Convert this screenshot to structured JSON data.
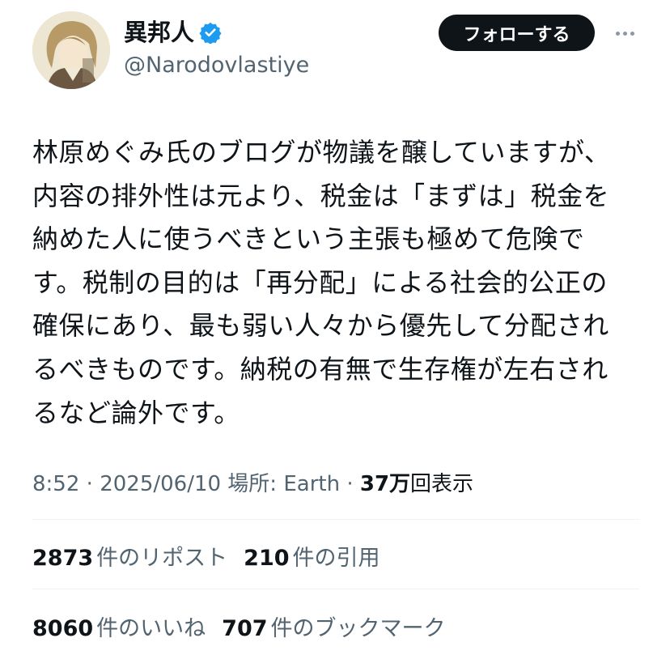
{
  "user": {
    "display_name": "異邦人",
    "handle": "@Narodovlastiye",
    "verified": true,
    "avatar": "anime-character-avatar"
  },
  "actions": {
    "follow_label": "フォローする",
    "more_icon": "more-horizontal-icon"
  },
  "tweet": {
    "lines": [
      "林原めぐみ氏のブログが物議を醸していますが、",
      "内容の排外性は元より、税金は「まずは」税金を",
      "納めた人に使うべきという主張も極めて危険で",
      "す。税制の目的は「再分配」による社会的公正の",
      "確保にあり、最も弱い人々から優先して分配され",
      "るべきものです。納税の有無で生存権が左右され",
      "るなど論外です。"
    ]
  },
  "meta": {
    "time": "8:52",
    "sep1": " · ",
    "date": "2025/06/10",
    "location": " 場所: Earth",
    "sep2": " · ",
    "views_count": "37万",
    "views_label": "回表示"
  },
  "stats": {
    "reposts_count": "2873",
    "reposts_label": "件のリポスト",
    "quotes_count": "210",
    "quotes_label": "件の引用",
    "likes_count": "8060",
    "likes_label": "件のいいね",
    "bookmarks_count": "707",
    "bookmarks_label": "件のブックマーク"
  },
  "colors": {
    "text": "#0f1419",
    "secondary": "#536471",
    "verified": "#1d9bf0",
    "follow_bg": "#0f1419",
    "divider": "#eff3f4"
  }
}
